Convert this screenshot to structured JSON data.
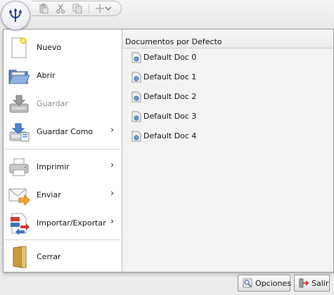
{
  "app_button": {
    "icon": "trident-logo-icon"
  },
  "quick_access": {
    "items": [
      "paste-icon",
      "cut-icon",
      "copy-icon",
      "customize-dropdown-icon"
    ]
  },
  "file_menu": {
    "items": [
      {
        "label": "Nuevo",
        "icon": "new-document-icon",
        "submenu": false,
        "enabled": true
      },
      {
        "label": "Abrir",
        "icon": "open-folder-icon",
        "submenu": false,
        "enabled": true
      },
      {
        "label": "Guardar",
        "icon": "save-disk-icon",
        "submenu": false,
        "enabled": false
      },
      {
        "label": "Guardar Como",
        "icon": "save-as-icon",
        "submenu": true,
        "enabled": true
      },
      {
        "label": "Imprimir",
        "icon": "printer-icon",
        "submenu": true,
        "enabled": true
      },
      {
        "label": "Enviar",
        "icon": "send-mail-icon",
        "submenu": true,
        "enabled": true
      },
      {
        "label": "Importar/Exportar",
        "icon": "import-export-icon",
        "submenu": true,
        "enabled": true
      },
      {
        "label": "Cerrar",
        "icon": "close-document-icon",
        "submenu": false,
        "enabled": true
      }
    ],
    "submenu_glyph": "›"
  },
  "recent_documents": {
    "header": "Documentos por Defecto",
    "items": [
      "Default Doc 0",
      "Default Doc 1",
      "Default Doc 2",
      "Default Doc 3",
      "Default Doc 4"
    ]
  },
  "footer": {
    "options_label": "Opciones",
    "exit_label": "Salir"
  }
}
